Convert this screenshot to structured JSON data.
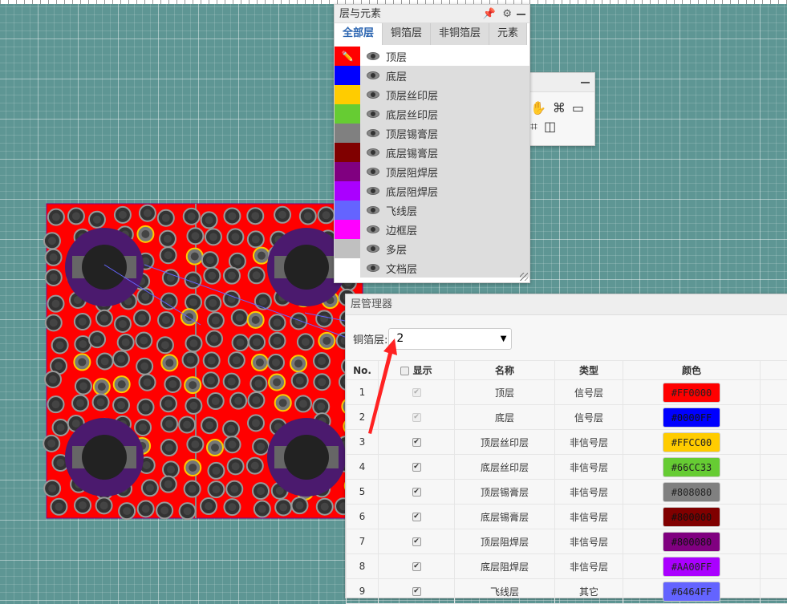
{
  "layers_panel": {
    "title": "层与元素",
    "tabs": [
      "全部层",
      "铜箔层",
      "非铜箔层",
      "元素"
    ],
    "layers": [
      {
        "name": "顶层",
        "color": "#FF0000",
        "active": true
      },
      {
        "name": "底层",
        "color": "#0000FF"
      },
      {
        "name": "顶层丝印层",
        "color": "#FFCC00"
      },
      {
        "name": "底层丝印层",
        "color": "#66CC33"
      },
      {
        "name": "顶层锡膏层",
        "color": "#808080"
      },
      {
        "name": "底层锡膏层",
        "color": "#800000"
      },
      {
        "name": "顶层阻焊层",
        "color": "#800080"
      },
      {
        "name": "底层阻焊层",
        "color": "#AA00FF"
      },
      {
        "name": "飞线层",
        "color": "#6464FF"
      },
      {
        "name": "边框层",
        "color": "#FF00FF"
      },
      {
        "name": "多层",
        "color": "#C0C0C0"
      },
      {
        "name": "文档层",
        "color": "#FFFFFF"
      }
    ]
  },
  "manager": {
    "title": "层管理器",
    "copper_label": "铜箔层:",
    "copper_value": "2",
    "headers": {
      "no": "No.",
      "show": "显示",
      "name": "名称",
      "type": "类型",
      "color": "颜色"
    },
    "rows": [
      {
        "no": "1",
        "name": "顶层",
        "type": "信号层",
        "color": "#FF0000",
        "disabled": true
      },
      {
        "no": "2",
        "name": "底层",
        "type": "信号层",
        "color": "#0000FF",
        "disabled": true
      },
      {
        "no": "3",
        "name": "顶层丝印层",
        "type": "非信号层",
        "color": "#FFCC00"
      },
      {
        "no": "4",
        "name": "底层丝印层",
        "type": "非信号层",
        "color": "#66CC33"
      },
      {
        "no": "5",
        "name": "顶层锡膏层",
        "type": "非信号层",
        "color": "#808080"
      },
      {
        "no": "6",
        "name": "底层锡膏层",
        "type": "非信号层",
        "color": "#800000"
      },
      {
        "no": "7",
        "name": "顶层阻焊层",
        "type": "非信号层",
        "color": "#800080"
      },
      {
        "no": "8",
        "name": "底层阻焊层",
        "type": "非信号层",
        "color": "#AA00FF"
      },
      {
        "no": "9",
        "name": "飞线层",
        "type": "其它",
        "color": "#6464FF"
      }
    ]
  }
}
